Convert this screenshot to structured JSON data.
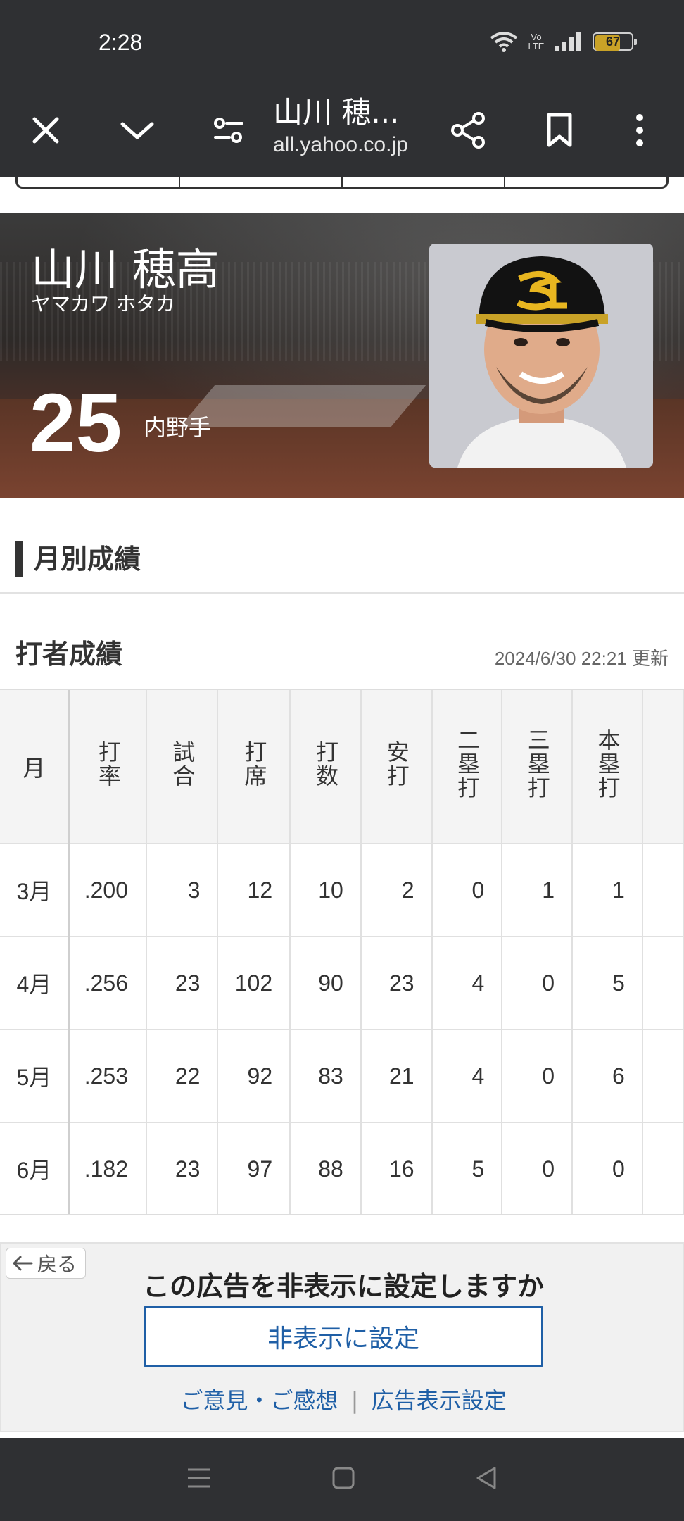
{
  "status_bar": {
    "time": "2:28",
    "network_label": "Vo LTE",
    "battery": "67"
  },
  "browser": {
    "title": "山川 穂...",
    "url": "all.yahoo.co.jp"
  },
  "player": {
    "name": "山川 穂高",
    "kana": "ヤマカワ ホタカ",
    "number": "25",
    "position": "内野手"
  },
  "section": {
    "title": "月別成績"
  },
  "batting": {
    "title": "打者成績",
    "updated": "2024/6/30 22:21 更新",
    "columns": [
      "月",
      "打率",
      "試合",
      "打席",
      "打数",
      "安打",
      "二塁打",
      "三塁打",
      "本塁打"
    ],
    "rows": [
      [
        "3月",
        ".200",
        "3",
        "12",
        "10",
        "2",
        "0",
        "1",
        "1"
      ],
      [
        "4月",
        ".256",
        "23",
        "102",
        "90",
        "23",
        "4",
        "0",
        "5"
      ],
      [
        "5月",
        ".253",
        "22",
        "92",
        "83",
        "21",
        "4",
        "0",
        "6"
      ],
      [
        "6月",
        ".182",
        "23",
        "97",
        "88",
        "16",
        "5",
        "0",
        "0"
      ]
    ]
  },
  "ad": {
    "back_label": "戻る",
    "question": "この広告を非表示に設定しますか",
    "hide_button": "非表示に設定",
    "feedback_link": "ご意見・ご感想",
    "settings_link": "広告表示設定"
  }
}
